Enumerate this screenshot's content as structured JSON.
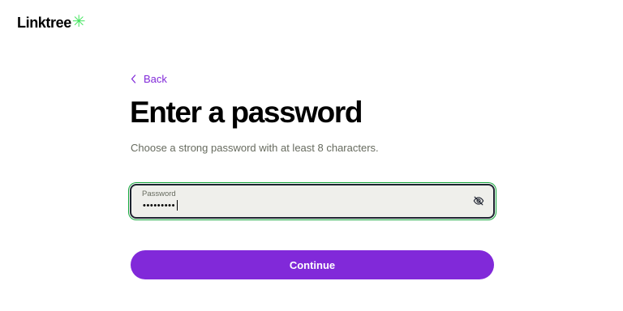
{
  "brand": {
    "name": "Linktree",
    "mark_color": "#43e55e"
  },
  "nav": {
    "back_label": "Back",
    "back_icon": "chevron-left-icon"
  },
  "heading": {
    "title": "Enter a password",
    "subtitle": "Choose a strong password with at least 8 characters."
  },
  "password_field": {
    "label": "Password",
    "value": "•••••••••",
    "visibility_icon": "eye-off-icon"
  },
  "actions": {
    "continue_label": "Continue"
  },
  "colors": {
    "accent": "#8129d9",
    "focus_ring": "#13a63a",
    "field_bg": "#efefeb",
    "muted_text": "#676b5f"
  }
}
